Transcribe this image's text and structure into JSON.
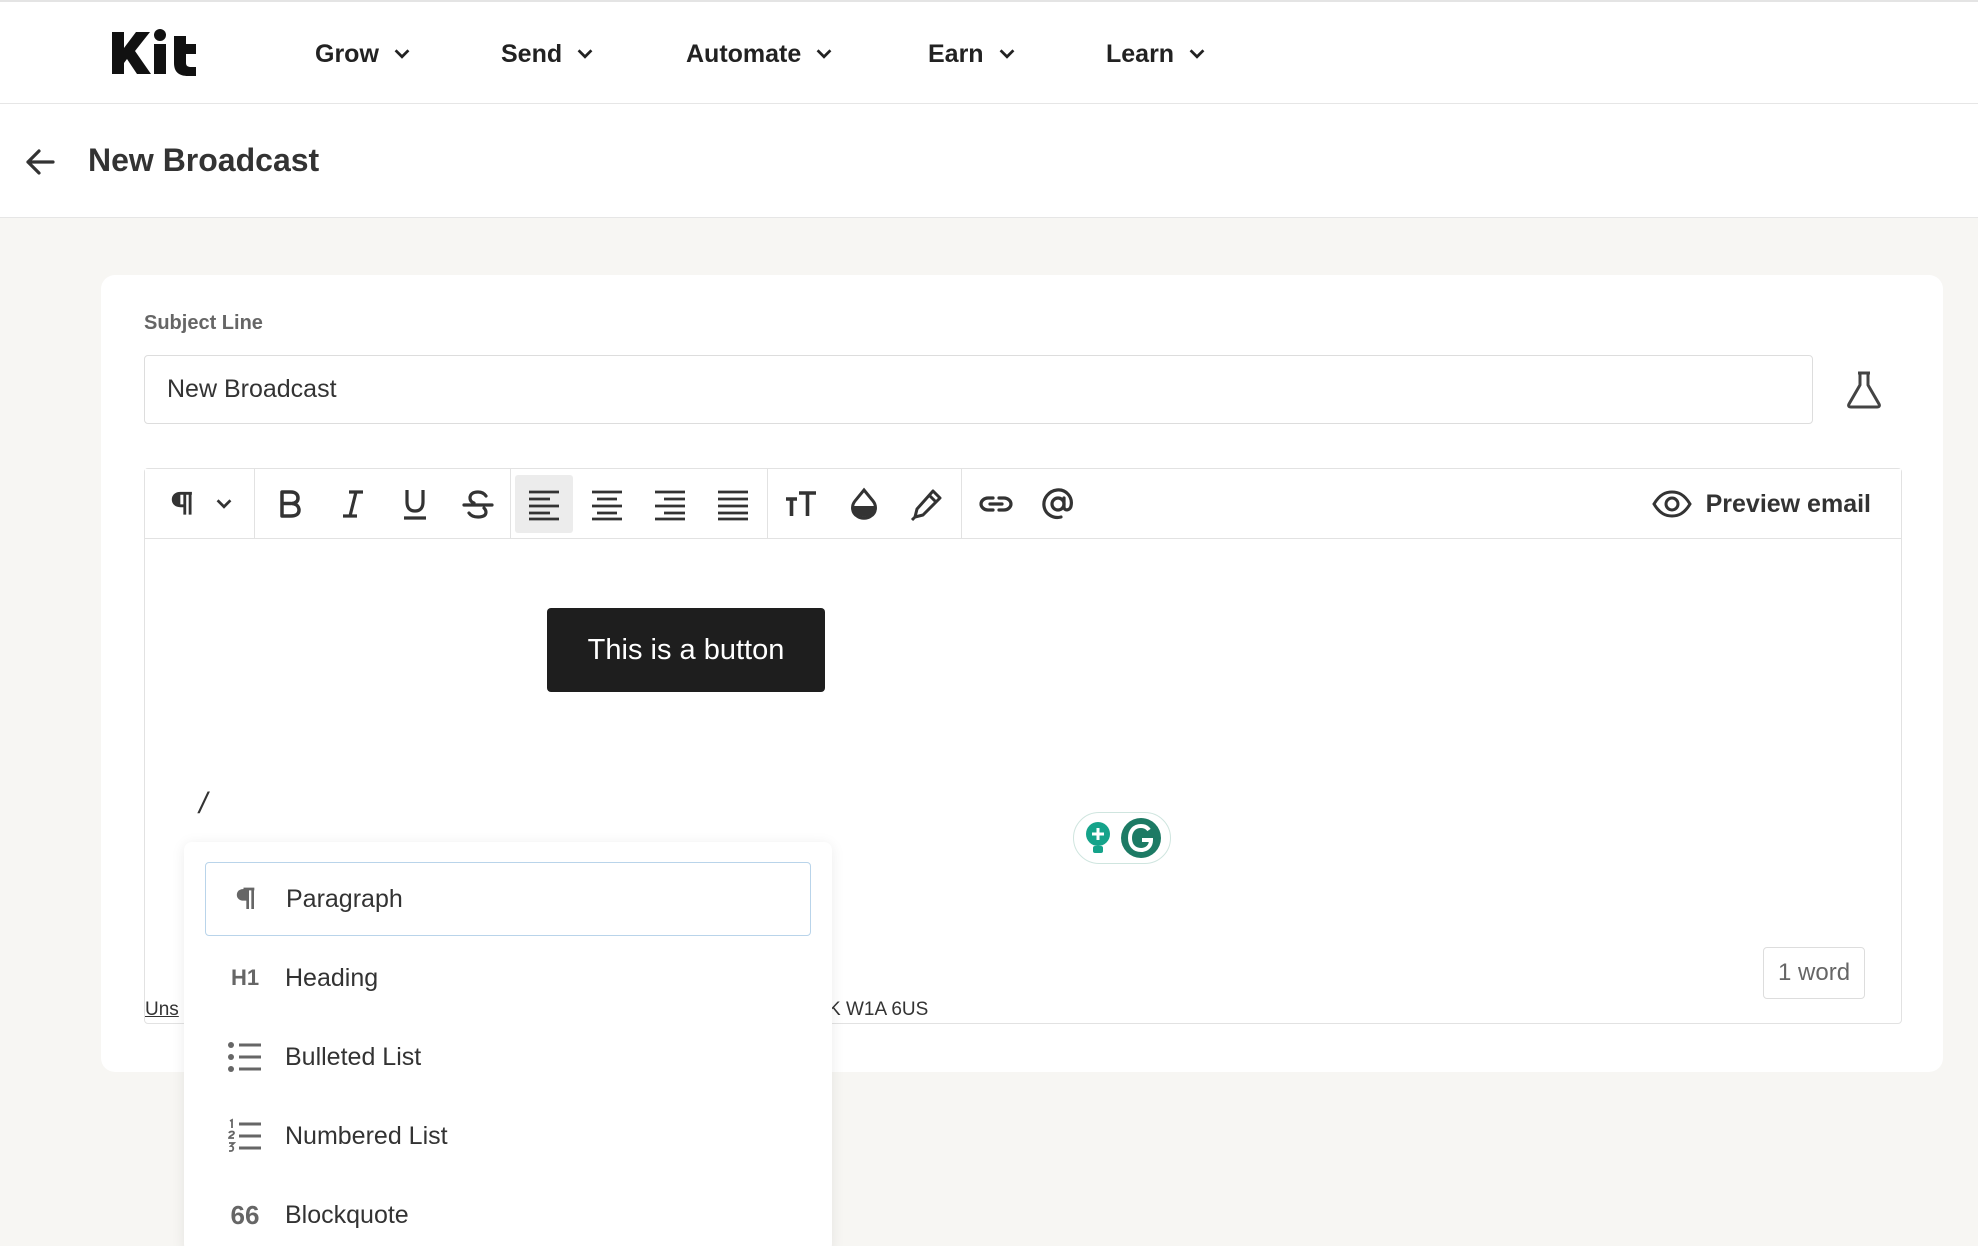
{
  "brand": {
    "logo_text": "Kit"
  },
  "nav": {
    "items": [
      {
        "label": "Grow"
      },
      {
        "label": "Send"
      },
      {
        "label": "Automate"
      },
      {
        "label": "Earn"
      },
      {
        "label": "Learn"
      }
    ]
  },
  "header": {
    "title": "New Broadcast"
  },
  "subject": {
    "label": "Subject Line",
    "value": "New Broadcast"
  },
  "toolbar": {
    "preview_label": "Preview email",
    "active_alignment": "align-left"
  },
  "editor": {
    "button_text": "This is a button",
    "typed_text": "/",
    "footer_link": "Uns",
    "footer_address": "K W1A 6US",
    "word_count": "1 word"
  },
  "menu": {
    "items": [
      {
        "label": "Paragraph",
        "icon": "paragraph-icon"
      },
      {
        "label": "Heading",
        "icon": "heading-icon",
        "glyph": "H1"
      },
      {
        "label": "Bulleted List",
        "icon": "bulleted-list-icon"
      },
      {
        "label": "Numbered List",
        "icon": "numbered-list-icon"
      },
      {
        "label": "Blockquote",
        "icon": "blockquote-icon",
        "glyph": "66"
      }
    ]
  },
  "colors": {
    "button_bg": "#1e1e1e",
    "page_bg": "#f7f6f3",
    "grammarly": "#15a38a"
  }
}
